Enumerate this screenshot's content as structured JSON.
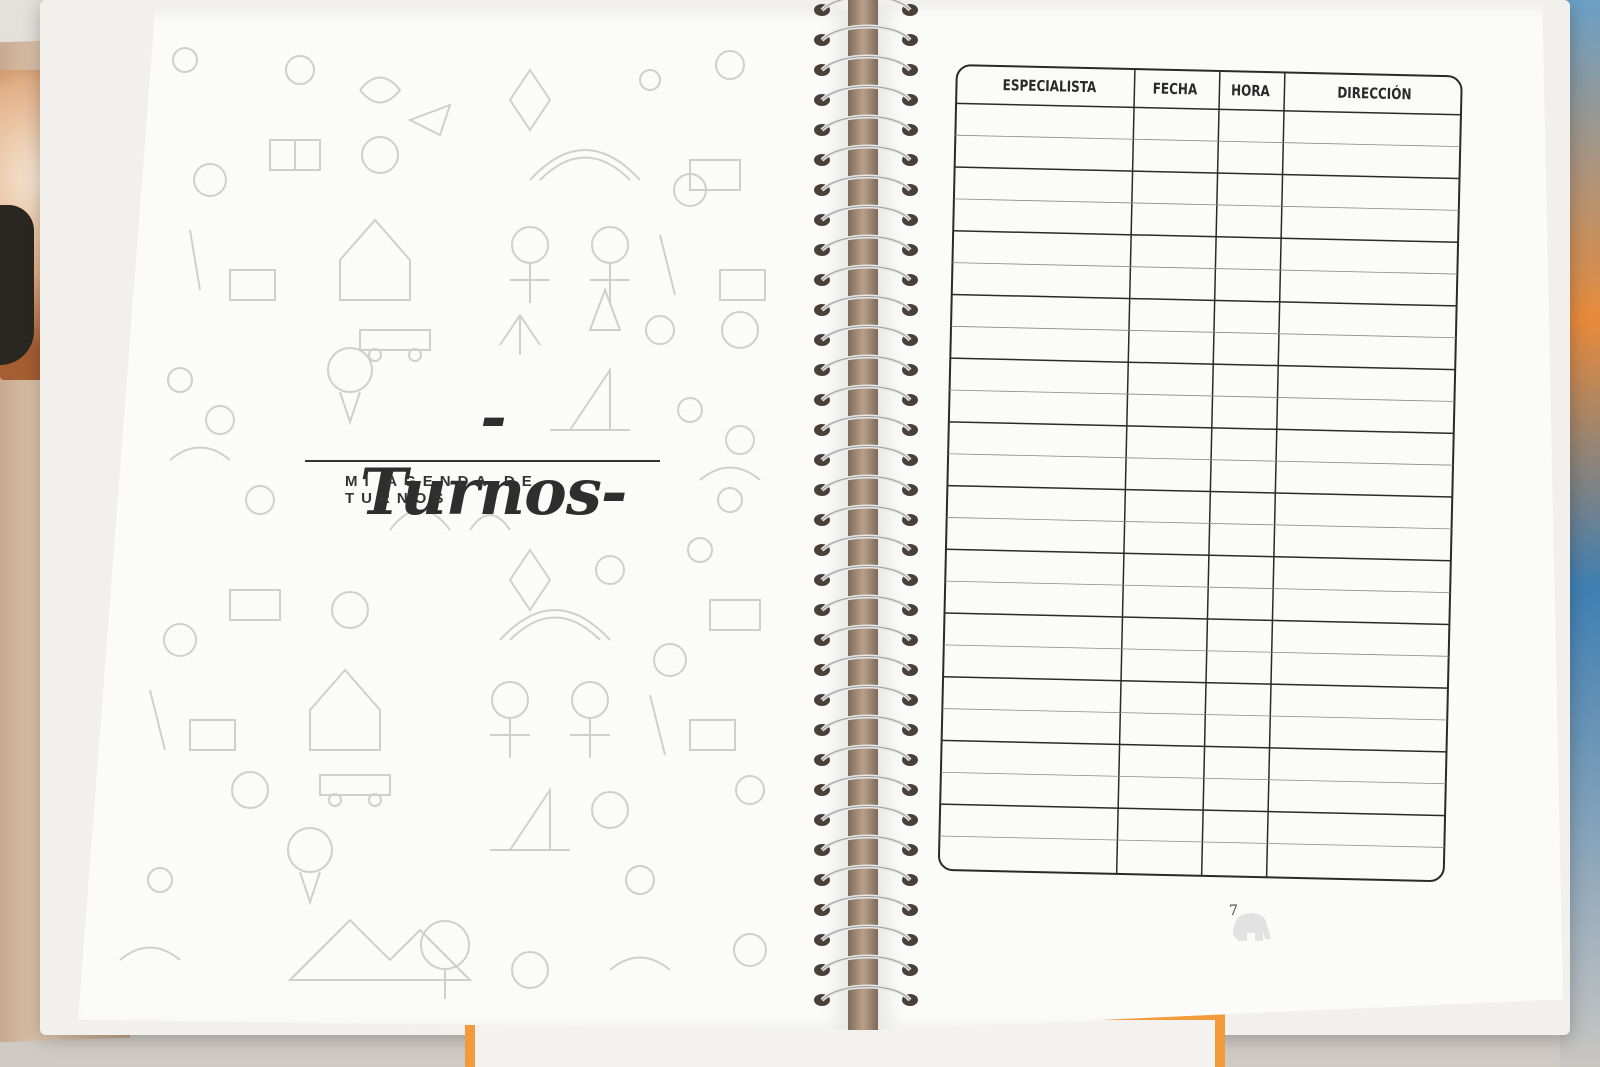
{
  "notebook": {
    "title": "-Turnos-",
    "subtitle": "MI AGENDA DE TURNOS",
    "table": {
      "columns": [
        "ESPECIALISTA",
        "FECHA",
        "HORA",
        "DIRECCIÓN"
      ],
      "row_count": 24
    },
    "page_number": "7"
  },
  "colors": {
    "page": "#fbfbfa",
    "ink": "#2e2e2e",
    "doodle": "#c9c9c9",
    "orange_edge": "#f39a3b"
  },
  "icons": [
    "elephant-icon",
    "spiral-binding",
    "doodle-pattern"
  ]
}
